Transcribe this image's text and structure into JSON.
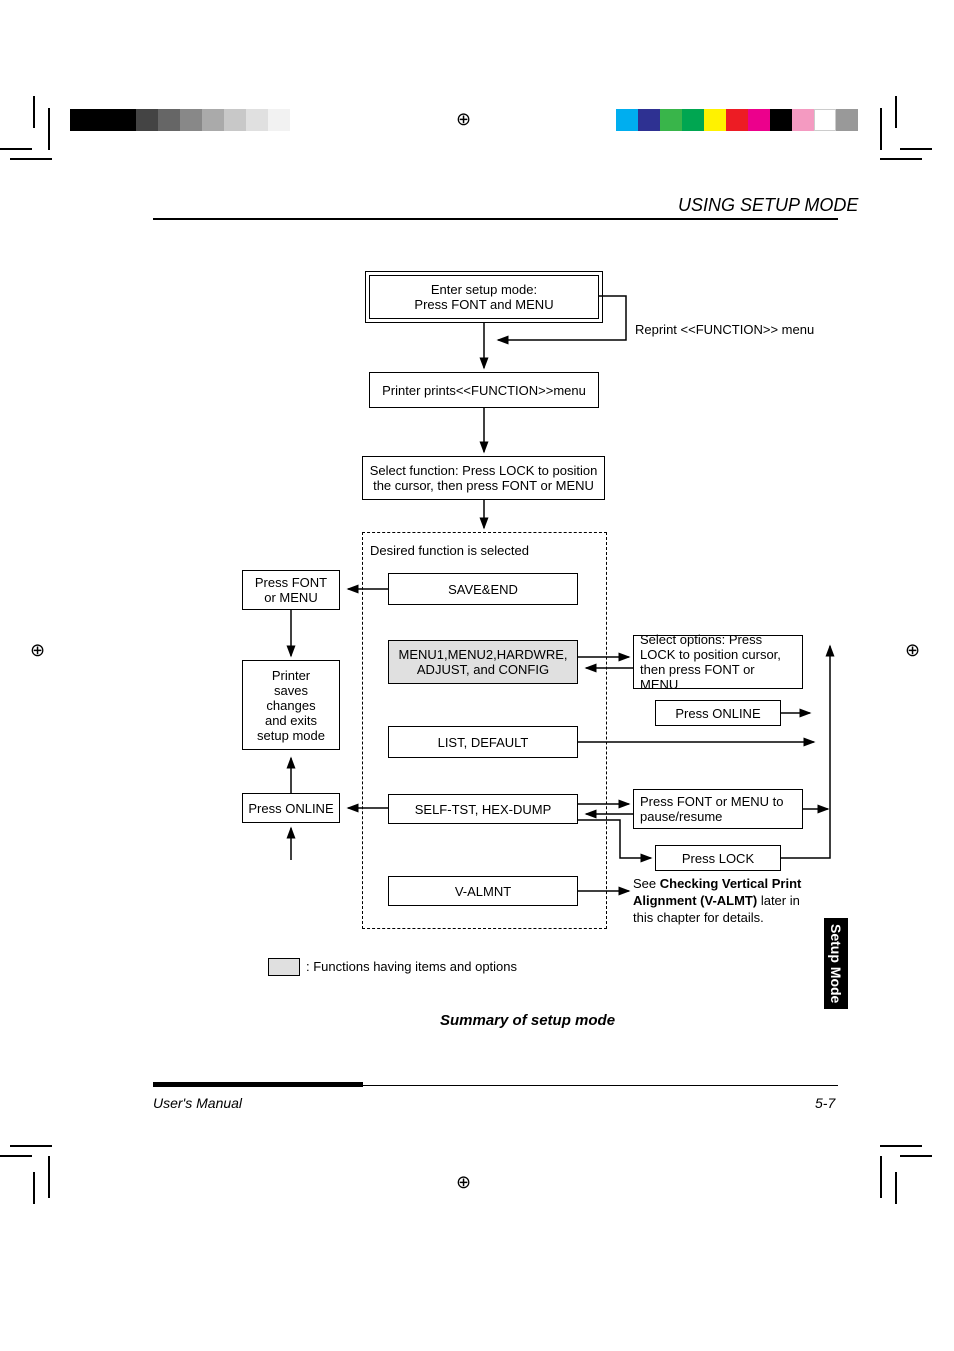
{
  "header": {
    "title": "USING SETUP MODE"
  },
  "flow": {
    "start_l1": "Enter setup mode:",
    "start_l2": "Press FONT and MENU",
    "reprint": "Reprint <<FUNCTION>> menu",
    "prints": "Printer prints<<FUNCTION>>menu",
    "select_l1": "Select function: Press LOCK to position",
    "select_l2": "the cursor, then press FONT or MENU",
    "desired": "Desired function is selected",
    "left_menu_l1": "Press FONT",
    "left_menu_l2": "or MENU",
    "save_end": "SAVE&END",
    "left_saves_l1": "Printer",
    "left_saves_l2": "saves",
    "left_saves_l3": "changes",
    "left_saves_l4": "and exits",
    "left_saves_l5": "setup mode",
    "config_l1": "MENU1,MENU2,HARDWRE,",
    "config_l2": "ADJUST, and CONFIG",
    "opt_l1": "Select options:  Press",
    "opt_l2": "LOCK to position cursor,",
    "opt_l3": "then press FONT or MENU",
    "online": "Press ONLINE",
    "list": "LIST, DEFAULT",
    "left_online": "Press ONLINE",
    "selftest": "SELF-TST, HEX-DUMP",
    "pause_l1": "Press FONT or MENU to",
    "pause_l2": "pause/resume",
    "lock": "Press LOCK",
    "valmnt": "V-ALMNT",
    "see_pre": "See ",
    "see_bold": "Checking Vertical Print Alignment (V-ALMT)",
    "see_post": " later in this chapter for details."
  },
  "legend": ": Functions having items and options",
  "caption": "Summary of setup mode",
  "tab": "Setup Mode",
  "footer": {
    "left": "User's Manual",
    "right": "5-7"
  }
}
